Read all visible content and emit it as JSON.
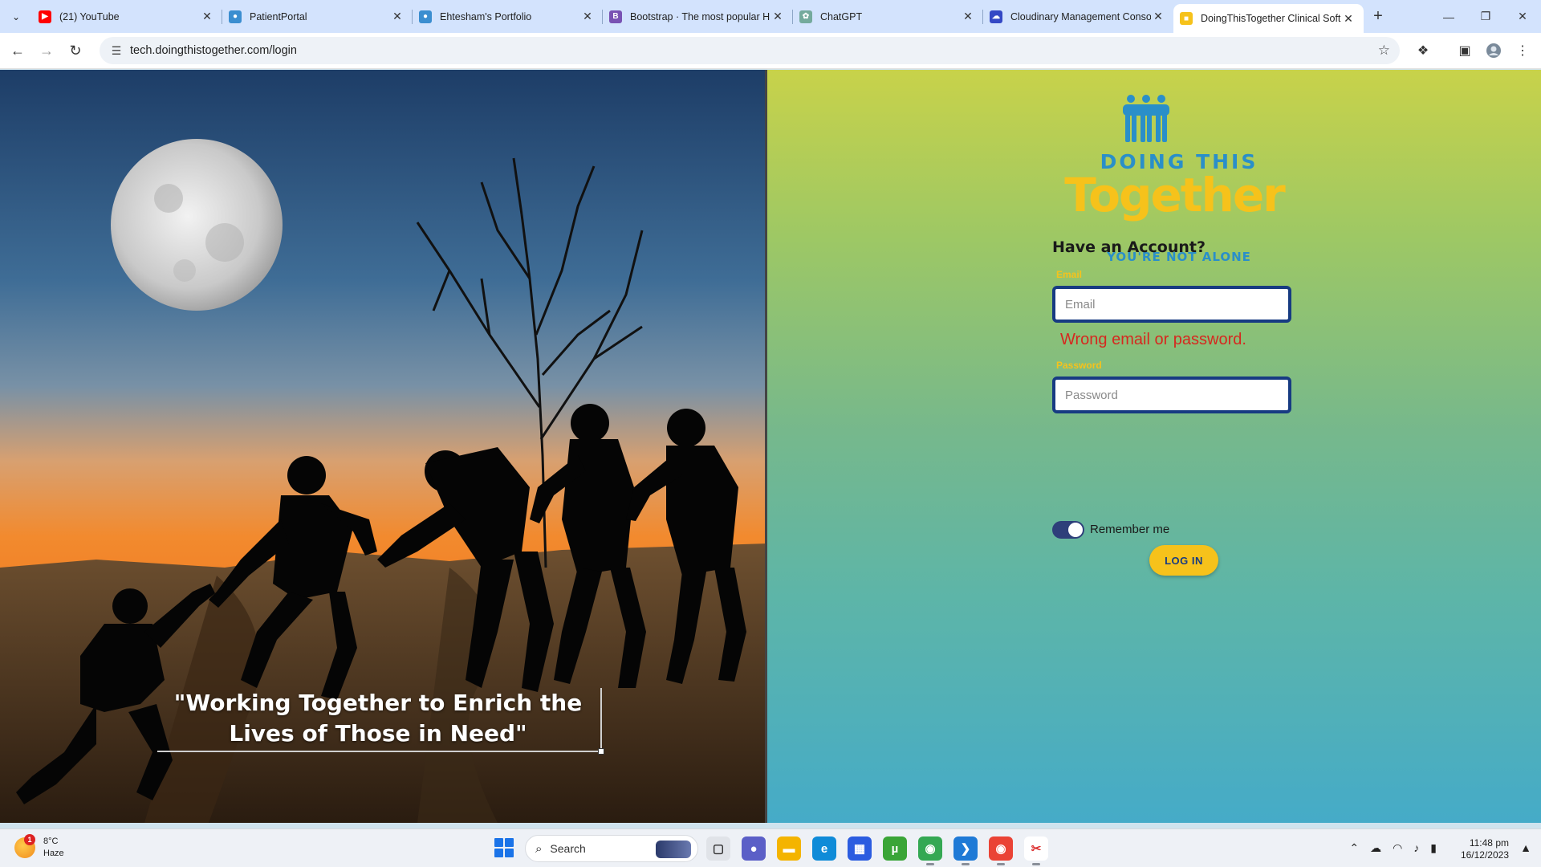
{
  "browser": {
    "tabs": [
      {
        "title": "(21) YouTube",
        "favicon": "youtube-icon",
        "color": "#ff0000",
        "active": false
      },
      {
        "title": "PatientPortal",
        "favicon": "globe-icon",
        "color": "#3b8ed0",
        "active": false
      },
      {
        "title": "Ehtesham's Portfolio",
        "favicon": "globe-icon",
        "color": "#3b8ed0",
        "active": false
      },
      {
        "title": "Bootstrap · The most popular H",
        "favicon": "bootstrap-icon",
        "color": "#7952b3",
        "active": false
      },
      {
        "title": "ChatGPT",
        "favicon": "chatgpt-icon",
        "color": "#74aa9c",
        "active": false
      },
      {
        "title": "Cloudinary Management Conso",
        "favicon": "cloudinary-icon",
        "color": "#3448c5",
        "active": false
      },
      {
        "title": "DoingThisTogether Clinical Soft",
        "favicon": "dtt-icon",
        "color": "#f6c21b",
        "active": true
      }
    ],
    "url": "tech.doingthistogether.com/login"
  },
  "hero": {
    "quote": "\"Working Together to Enrich the Lives of Those in Need\""
  },
  "logo": {
    "line1": "DOING THIS",
    "line2": "Together",
    "line3": "YOU'RE NOT ALONE"
  },
  "login": {
    "title": "Have an Account?",
    "email_label": "Email",
    "email_placeholder": "Email",
    "error": "Wrong email or password.",
    "password_label": "Password",
    "password_placeholder": "Password",
    "remember_label": "Remember me",
    "remember_on": true,
    "button": "LOG IN"
  },
  "colors": {
    "accent_yellow": "#f6c21b",
    "brand_blue": "#2a8fc9",
    "input_border": "#173b82",
    "error_red": "#d6281f"
  },
  "taskbar": {
    "weather_temp": "8°C",
    "weather_desc": "Haze",
    "weather_badge": "1",
    "search_label": "Search",
    "time": "11:48 pm",
    "date": "16/12/2023"
  }
}
